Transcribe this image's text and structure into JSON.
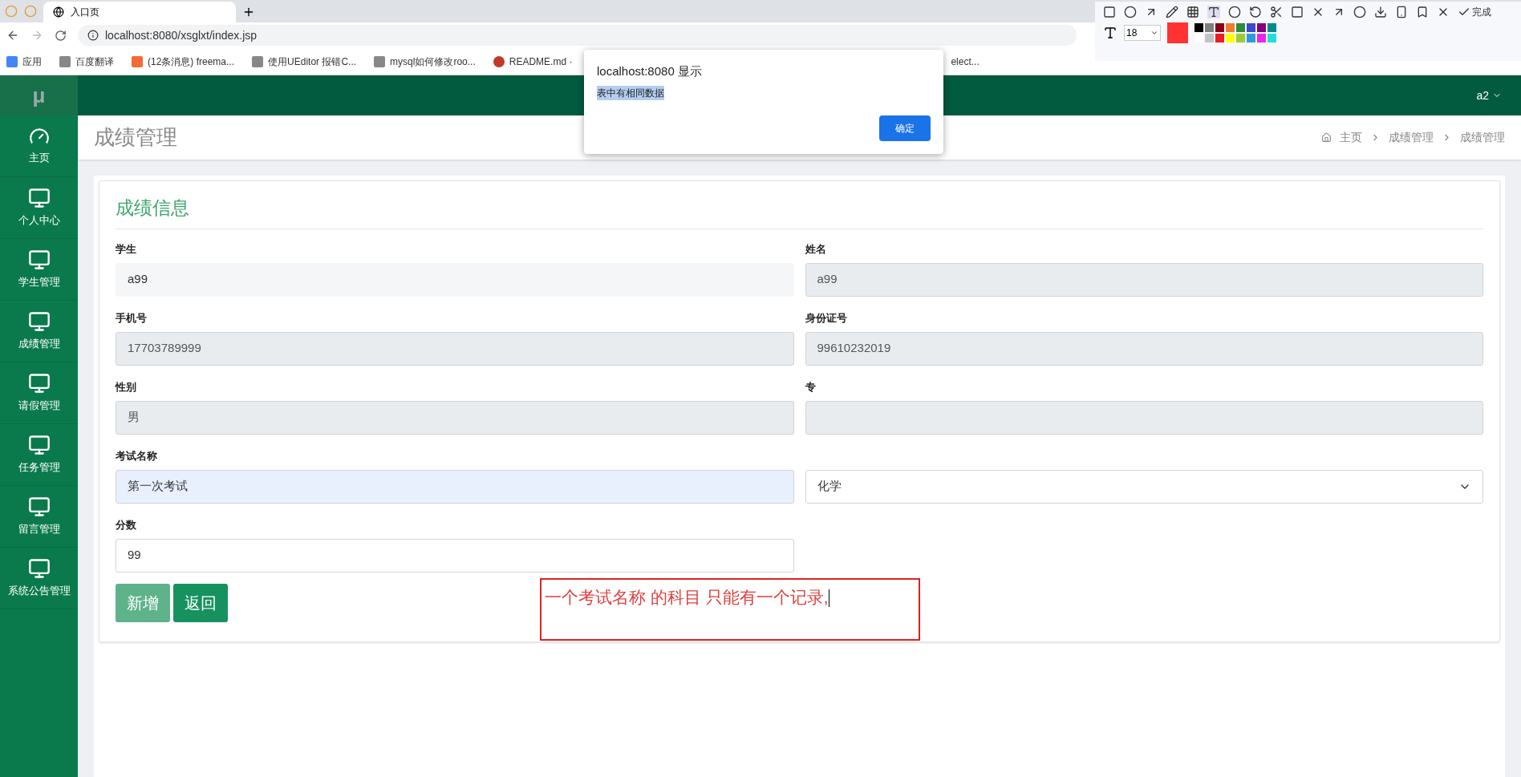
{
  "browser": {
    "tabs": [
      {
        "title": "入口页",
        "selected": true
      }
    ],
    "address": "localhost:8080/xsglxt/index.jsp",
    "bookmarks": [
      "应用",
      "百度翻译",
      "(12条消息) freema...",
      "使用UEditor 报错C...",
      "mysql如何修改roo...",
      "README.md ·",
      "elect..."
    ]
  },
  "capture_toolbar": {
    "done_label": "完成",
    "font_size": "18",
    "palette": [
      {
        "color": "#000000"
      },
      {
        "color": "#7f7f7f"
      },
      {
        "color": "#880015"
      },
      {
        "color": "#ed7d31"
      },
      {
        "color": "#2e8b3a"
      },
      {
        "color": "#3f48cc"
      },
      {
        "color": "#800080"
      },
      {
        "color": "#008b8b"
      },
      {
        "color": "#ffffff"
      },
      {
        "color": "#c3c3c3"
      },
      {
        "color": "#ed1c24"
      },
      {
        "color": "#ffff00"
      },
      {
        "color": "#9acd32"
      },
      {
        "color": "#3399dd"
      },
      {
        "color": "#ee22ee"
      },
      {
        "color": "#22dddd"
      }
    ],
    "current_swatch": {
      "color": "#ff3333"
    }
  },
  "header": {
    "logo": "μ",
    "user": "a2"
  },
  "sidebar": {
    "items": [
      {
        "label": "主页",
        "kind": "dashboard"
      },
      {
        "label": "个人中心",
        "kind": "monitor"
      },
      {
        "label": "学生管理",
        "kind": "monitor"
      },
      {
        "label": "成绩管理",
        "kind": "monitor"
      },
      {
        "label": "请假管理",
        "kind": "monitor"
      },
      {
        "label": "任务管理",
        "kind": "monitor"
      },
      {
        "label": "留言管理",
        "kind": "monitor"
      },
      {
        "label": "系统公告管理",
        "kind": "monitor"
      }
    ]
  },
  "page": {
    "title": "成绩管理",
    "breadcrumb": [
      "主页",
      "成绩管理",
      "成绩管理"
    ]
  },
  "form": {
    "title": "成绩信息",
    "fields": [
      {
        "label": "学生",
        "value": "a99",
        "kind": "readonly"
      },
      {
        "label": "姓名",
        "value": "a99",
        "kind": "disabled"
      },
      {
        "label": "手机号",
        "value": "17703789999",
        "kind": "disabled"
      },
      {
        "label": "身份证号",
        "value": "99610232019",
        "kind": "disabled"
      },
      {
        "label": "性别",
        "value": "男",
        "kind": "disabled"
      },
      {
        "label": "专",
        "kind": "disabled"
      },
      {
        "label": "考试名称",
        "value": "第一次考试",
        "kind": "autofill"
      },
      {
        "value": "化学",
        "kind": "select"
      },
      {
        "label": "分数",
        "value": "99",
        "kind": "input"
      }
    ],
    "buttons": [
      "新增",
      "返回"
    ]
  },
  "annotation": {
    "text": "一个考试名称 的科目  只能有一个记录,"
  },
  "dialog": {
    "title": "localhost:8080 显示",
    "message": "表中有相同数据",
    "button": "确定"
  }
}
